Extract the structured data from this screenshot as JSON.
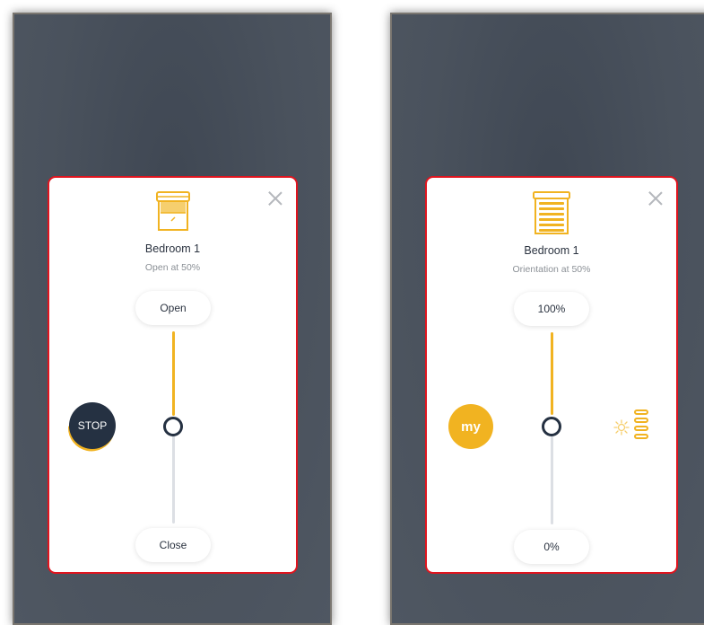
{
  "accent_color": "#f1b321",
  "dark_color": "#253142",
  "highlight_border_color": "#e0141e",
  "left_card": {
    "device_icon": "roller-shade-icon",
    "device_name": "Bedroom 1",
    "status": "Open at 50%",
    "top_button": "Open",
    "bottom_button": "Close",
    "slider_value_percent": 50,
    "action_button": "STOP"
  },
  "right_card": {
    "device_icon": "venetian-blind-icon",
    "device_name": "Bedroom 1",
    "status": "Orientation at 50%",
    "top_button": "100%",
    "bottom_button": "0%",
    "slider_value_percent": 50,
    "action_button": "my",
    "mode_icon": "sun-slats-icon"
  }
}
